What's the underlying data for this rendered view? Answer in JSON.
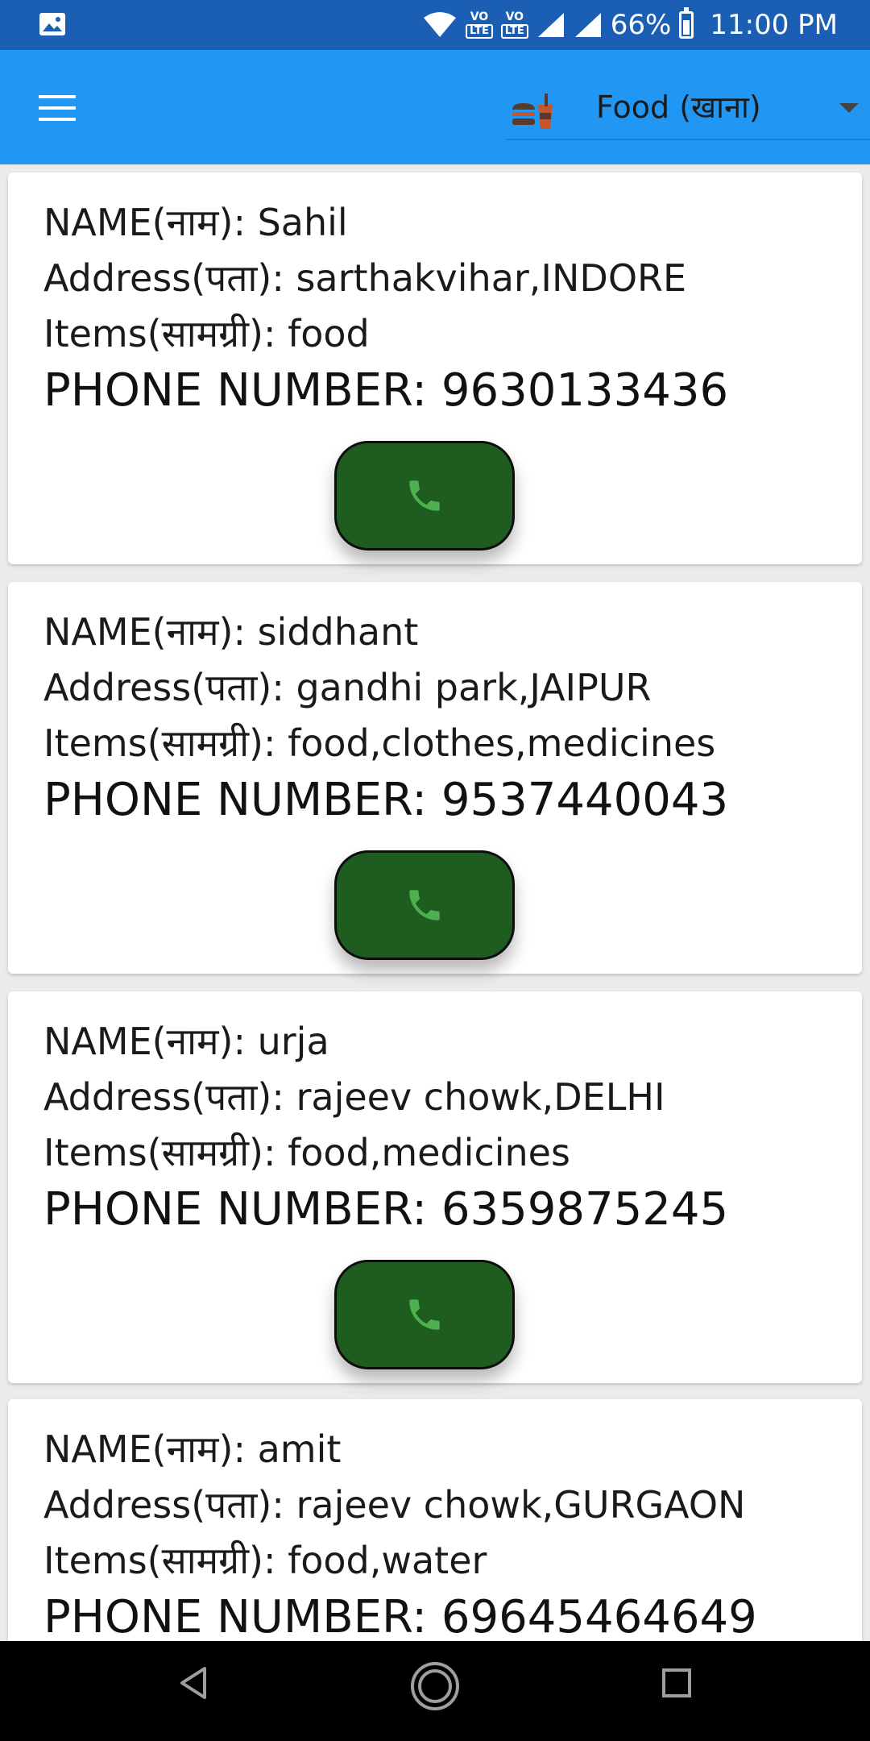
{
  "status_bar": {
    "battery": "66%",
    "time": "11:00 PM",
    "volte1": "VO",
    "volte1_sub": "LTE",
    "volte2": "VO",
    "volte2_sub": "LTE"
  },
  "app_bar": {
    "category_selected": "Food (खाना)"
  },
  "donors": [
    {
      "name": "NAME(नाम): Sahil",
      "address": "Address(पता): sarthakvihar,INDORE",
      "items": "Items(सामग्री): food",
      "phone": "PHONE NUMBER: 9630133436"
    },
    {
      "name": "NAME(नाम): siddhant",
      "address": "Address(पता): gandhi park,JAIPUR",
      "items": "Items(सामग्री): food,clothes,medicines",
      "phone": "PHONE NUMBER: 9537440043"
    },
    {
      "name": "NAME(नाम): urja",
      "address": "Address(पता): rajeev chowk,DELHI",
      "items": "Items(सामग्री): food,medicines",
      "phone": "PHONE NUMBER: 6359875245"
    },
    {
      "name": "NAME(नाम): amit",
      "address": "Address(पता): rajeev chowk,GURGAON",
      "items": "Items(सामग्री): food,water",
      "phone": "PHONE NUMBER: 69645464649"
    }
  ],
  "colors": {
    "status_bar": "#1a5fb4",
    "app_bar": "#2196f3",
    "call_button": "#1f5c1f",
    "call_icon": "#4caf50"
  },
  "icons": {
    "menu": "hamburger-menu-icon",
    "category": "food-drink-icon",
    "call": "phone-icon",
    "nav_back": "back-triangle-icon",
    "nav_home": "home-circle-icon",
    "nav_recents": "recents-square-icon"
  }
}
